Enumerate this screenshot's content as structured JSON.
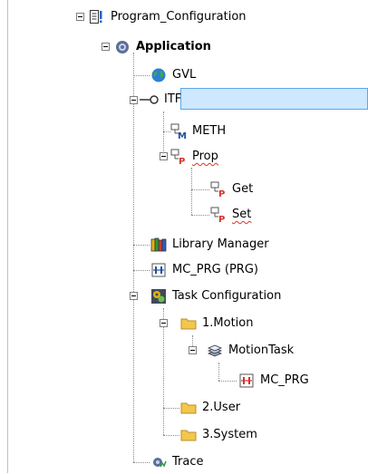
{
  "tree": {
    "program_configuration": "Program_Configuration",
    "application": "Application",
    "gvl": "GVL",
    "itf": "ITF",
    "meth": "METH",
    "prop": "Prop",
    "get": "Get",
    "set": "Set",
    "library_manager": "Library Manager",
    "mc_prg_pou": "MC_PRG (PRG)",
    "task_configuration": "Task Configuration",
    "motion_folder": "1.Motion",
    "motion_task": "MotionTask",
    "mc_prg_call": "MC_PRG",
    "user_folder": "2.User",
    "system_folder": "3.System",
    "trace": "Trace"
  },
  "colors": {
    "selection_bg": "#cde8ff",
    "selection_border": "#5aa8e6",
    "folder": "#f3c64d",
    "spell_underline": "#e0302a"
  }
}
